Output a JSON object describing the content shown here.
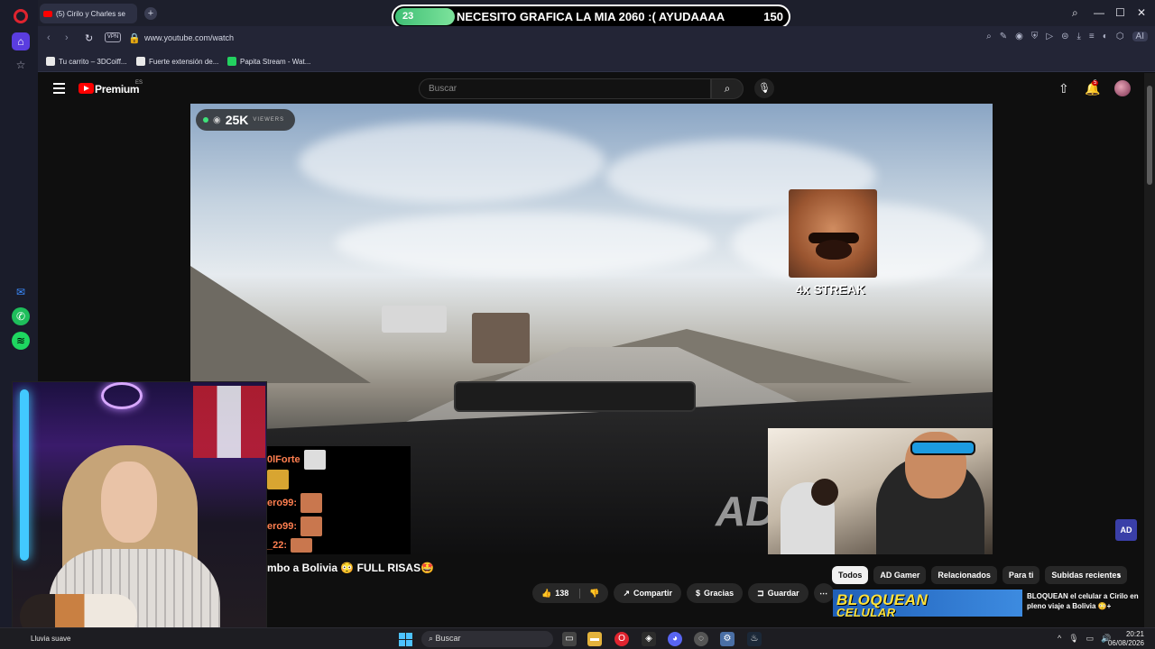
{
  "browser": {
    "tab_title": "(5) Cirilo y Charles se ",
    "url": "www.youtube.com/watch",
    "vpn_label": "VPN",
    "ai_label": "AI",
    "bookmarks": [
      "Tu carrito – 3DCoiff...",
      "Fuerte extensión de...",
      "Papita Stream - Wat..."
    ]
  },
  "overlay": {
    "goal_current": "23",
    "goal_text": "NECESITO GRAFICA LA MIA 2060 :( AYUDAAAA",
    "goal_target": "150",
    "goal_progress": 0.153,
    "viewers": "25K",
    "viewers_label": "VIEWERS",
    "streak": "4x STREAK",
    "chat": [
      "0lForte",
      "ero99:",
      "ero99:",
      "_22:"
    ]
  },
  "youtube": {
    "brand": "Premium",
    "region": "ES",
    "search_placeholder": "Buscar",
    "notifications": "5",
    "video_title": "mbo a Bolivia 😳 FULL RISAS🤩",
    "actions": {
      "likes": "138",
      "share": "Compartir",
      "thanks": "Gracias",
      "save": "Guardar"
    },
    "chips": [
      "Todos",
      "AD Gamer",
      "Relacionados",
      "Para ti",
      "Subidas recientes"
    ],
    "recommended": {
      "thumb_text": "BLOQUEAN",
      "thumb_text2": "CELULAR",
      "title": "BLOQUEAN el celular a Cirilo en pleno viaje a Bolivia 😳+"
    },
    "watermark": "AD",
    "ad_badge": "AD"
  },
  "taskbar": {
    "weather": "Lluvia suave",
    "search": "Buscar",
    "time": "20:21",
    "date": "06/08/2026"
  },
  "colors": {
    "youtube_red": "#ff0000",
    "goal_green": "#3fbf75",
    "opera_red": "#e0242f"
  }
}
